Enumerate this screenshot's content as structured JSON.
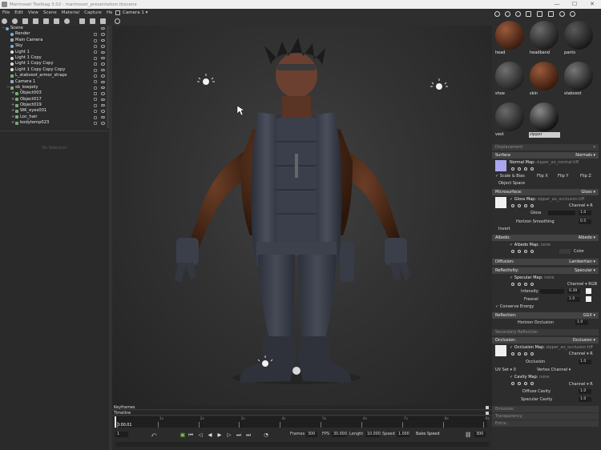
{
  "window": {
    "title": "Marmoset Toolbag 3.02 - marmoset_presentation.tbscene",
    "controls": [
      "—",
      "☐",
      "✕"
    ]
  },
  "menu": [
    "File",
    "Edit",
    "View",
    "Scene",
    "Material",
    "Capture",
    "Help"
  ],
  "viewport": {
    "camera_label": "Camera 1 ▾"
  },
  "outliner": {
    "items": [
      {
        "label": "Scene",
        "depth": 0,
        "expander": "−",
        "icon": "scene"
      },
      {
        "label": "Render",
        "depth": 1,
        "expander": "",
        "icon": "render"
      },
      {
        "label": "Main Camera",
        "depth": 1,
        "expander": "",
        "icon": "cam"
      },
      {
        "label": "Sky",
        "depth": 1,
        "expander": "",
        "icon": "sky"
      },
      {
        "label": "Light 1",
        "depth": 1,
        "expander": "",
        "icon": "light"
      },
      {
        "label": "Light 1 Copy",
        "depth": 1,
        "expander": "",
        "icon": "light"
      },
      {
        "label": "Light 1 Copy Copy",
        "depth": 1,
        "expander": "",
        "icon": "light"
      },
      {
        "label": "Light 1 Copy Copy Copy",
        "depth": 1,
        "expander": "",
        "icon": "light"
      },
      {
        "label": "L_stabvest_armor_straps",
        "depth": 1,
        "expander": "",
        "icon": "mesh"
      },
      {
        "label": "Camera 1",
        "depth": 1,
        "expander": "",
        "icon": "cam"
      },
      {
        "label": "sb_lowpoly",
        "depth": 1,
        "expander": "−",
        "icon": "mesh"
      },
      {
        "label": "Object003",
        "depth": 2,
        "expander": "+",
        "icon": "mesh"
      },
      {
        "label": "Object017",
        "depth": 2,
        "expander": "+",
        "icon": "mesh"
      },
      {
        "label": "Object019",
        "depth": 2,
        "expander": "+",
        "icon": "mesh"
      },
      {
        "label": "WK_eyes001",
        "depth": 2,
        "expander": "+",
        "icon": "mesh"
      },
      {
        "label": "Loc_hair",
        "depth": 2,
        "expander": "+",
        "icon": "mesh"
      },
      {
        "label": "bodytemp023",
        "depth": 2,
        "expander": "+",
        "icon": "mesh"
      }
    ]
  },
  "selection_panel": {
    "empty_text": "No Selection"
  },
  "timeline": {
    "keyframes_label": "Keyframes",
    "timeline_label": "Timeline",
    "ticks": [
      "0",
      "1s",
      "2s",
      "3s",
      "4s",
      "5s",
      "6s",
      "7s",
      "8s",
      "9s"
    ],
    "current_time": "0:00.01",
    "frame_field": "1",
    "frames_label": "Frames",
    "frames_value": "300",
    "fps_label": "FPS",
    "fps_value": "30.000",
    "length_label": "Length",
    "length_value": "10.000",
    "speed_label": "Speed",
    "speed_value": "1.000",
    "bake_label": "Bake Speed",
    "end_value": "300"
  },
  "materials": {
    "items": [
      {
        "name": "head",
        "color_a": "#9a5a3a",
        "color_b": "#3a1c10",
        "selected": false
      },
      {
        "name": "headband",
        "color_a": "#6a6a6a",
        "color_b": "#1c1c1c",
        "selected": false
      },
      {
        "name": "pants",
        "color_a": "#5a5a5a",
        "color_b": "#181818",
        "selected": false
      },
      {
        "name": "shoe",
        "color_a": "#707070",
        "color_b": "#222222",
        "selected": false
      },
      {
        "name": "skin",
        "color_a": "#9a5a3a",
        "color_b": "#3a1a0c",
        "selected": false
      },
      {
        "name": "stabvest",
        "color_a": "#777777",
        "color_b": "#1a1a1a",
        "selected": false
      },
      {
        "name": "vest",
        "color_a": "#6a6a6a",
        "color_b": "#1e1e1e",
        "selected": false
      },
      {
        "name": "zipper",
        "color_a": "#8a8a8a",
        "color_b": "#111111",
        "selected": true
      }
    ]
  },
  "properties": {
    "displacement": {
      "title": "Displacement",
      "value": "▾"
    },
    "surface": {
      "title": "Surface",
      "mode": "Normals ▾",
      "normal_map_label": "Normal Map:",
      "normal_map_file": "zipper_ao_normal.tiff",
      "scale_bias": "Scale & Bias",
      "flip_x": "Flip X",
      "flip_y": "Flip Y",
      "flip_z": "Flip Z",
      "object_space": "Object Space",
      "swatch_color": "#a9a6ee"
    },
    "microsurface": {
      "title": "Microsurface:",
      "mode": "Gloss ▾",
      "map_label": "Gloss Map:",
      "map_file": "zipper_ao_occlusion.tiff",
      "channel": "Channel ▾",
      "channel_value": "R",
      "gloss_label": "Gloss",
      "gloss_value": "1.0",
      "horizon_label": "Horizon Smoothing",
      "horizon_value": "0.5",
      "invert": "Invert"
    },
    "albedo": {
      "title": "Albedo:",
      "mode": "Albedo ▾",
      "map_label": "Albedo Map:",
      "map_value": "none",
      "color_label": "Color"
    },
    "diffusion": {
      "title": "Diffusion:",
      "mode": "Lambertian ▾"
    },
    "reflectivity": {
      "title": "Reflectivity:",
      "mode": "Specular ▾",
      "map_label": "Specular Map:",
      "map_value": "none",
      "channel": "Channel ▾",
      "channel_value": "RGB",
      "intensity_label": "Intensity",
      "intensity_value": "0.39",
      "fresnel_label": "Fresnel",
      "fresnel_value": "1.0",
      "conserve": "Conserve Energy"
    },
    "reflection": {
      "title": "Reflection:",
      "mode": "GGX ▾",
      "horizon_label": "Horizon Occlusion",
      "horizon_value": "1.0"
    },
    "secondary": {
      "title": "Secondary Reflection"
    },
    "occlusion": {
      "title": "Occlusion:",
      "mode": "Occlusion ▾",
      "map_label": "Occlusion Map:",
      "map_file": "zipper_ao_occlusion.tiff",
      "channel": "Channel ▾",
      "channel_value": "R",
      "occ_label": "Occlusion",
      "occ_value": "1.0",
      "uv_label": "UV Set ▾",
      "uv_value": "0",
      "vertex_label": "Vertex Channel ▾",
      "cavity_label": "Cavity Map:",
      "cavity_value": "none",
      "channel2": "Channel ▾",
      "channel2_value": "R",
      "diffuse_cav_label": "Diffuse Cavity",
      "diffuse_cav_value": "1.0",
      "spec_cav_label": "Specular Cavity",
      "spec_cav_value": "1.0"
    },
    "emissive": {
      "title": "Emissive:"
    },
    "transparency": {
      "title": "Transparency:"
    },
    "extra": {
      "title": "Extra:"
    }
  }
}
